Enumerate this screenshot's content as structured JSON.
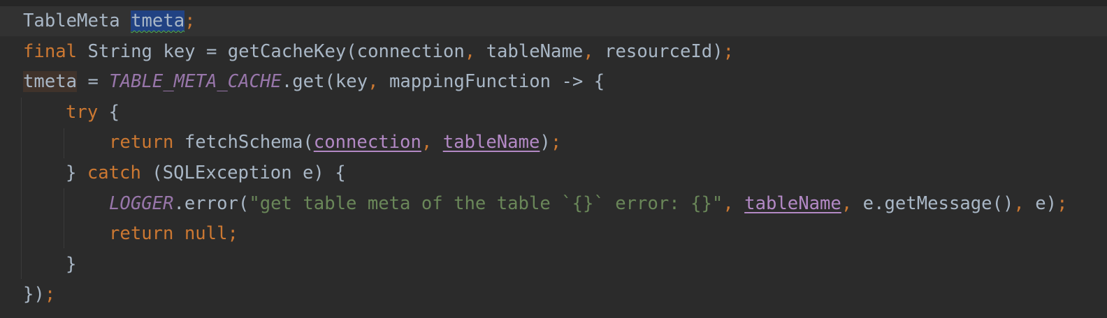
{
  "editor": {
    "lines": [
      {
        "indent": 1,
        "tokens": [
          {
            "t": "TableMeta ",
            "c": "id"
          },
          {
            "t": "tmeta",
            "c": "id sel"
          },
          {
            "t": ";",
            "c": "punc"
          }
        ]
      },
      {
        "indent": 1,
        "tokens": [
          {
            "t": "final",
            "c": "kw"
          },
          {
            "t": " String key = getCacheKey(connection",
            "c": "id"
          },
          {
            "t": ", ",
            "c": "punc"
          },
          {
            "t": "tableName",
            "c": "id"
          },
          {
            "t": ", ",
            "c": "punc"
          },
          {
            "t": "resourceId)",
            "c": "id"
          },
          {
            "t": ";",
            "c": "punc"
          }
        ]
      },
      {
        "indent": 1,
        "tokens": [
          {
            "t": "tmeta",
            "c": "id write-hl"
          },
          {
            "t": " = ",
            "c": "id"
          },
          {
            "t": "TABLE_META_CACHE",
            "c": "static"
          },
          {
            "t": ".get(key",
            "c": "id"
          },
          {
            "t": ", ",
            "c": "punc"
          },
          {
            "t": "mappingFunction -> {",
            "c": "id"
          }
        ]
      },
      {
        "indent": 2,
        "tokens": [
          {
            "t": "try",
            "c": "kw"
          },
          {
            "t": " {",
            "c": "id"
          }
        ]
      },
      {
        "indent": 3,
        "tokens": [
          {
            "t": "return",
            "c": "kw"
          },
          {
            "t": " fetchSchema(",
            "c": "id"
          },
          {
            "t": "connection",
            "c": "param"
          },
          {
            "t": ", ",
            "c": "punc"
          },
          {
            "t": "tableName",
            "c": "param"
          },
          {
            "t": ")",
            "c": "id"
          },
          {
            "t": ";",
            "c": "punc"
          }
        ]
      },
      {
        "indent": 2,
        "tokens": [
          {
            "t": "} ",
            "c": "id"
          },
          {
            "t": "catch",
            "c": "kw"
          },
          {
            "t": " (SQLException e) {",
            "c": "id"
          }
        ]
      },
      {
        "indent": 3,
        "tokens": [
          {
            "t": "LOGGER",
            "c": "static"
          },
          {
            "t": ".error(",
            "c": "id"
          },
          {
            "t": "\"get table meta of the table `{}` error: {}\"",
            "c": "str"
          },
          {
            "t": ", ",
            "c": "punc"
          },
          {
            "t": "tableName",
            "c": "param"
          },
          {
            "t": ", ",
            "c": "punc"
          },
          {
            "t": "e.getMessage()",
            "c": "id"
          },
          {
            "t": ", ",
            "c": "punc"
          },
          {
            "t": "e)",
            "c": "id"
          },
          {
            "t": ";",
            "c": "punc"
          }
        ]
      },
      {
        "indent": 3,
        "tokens": [
          {
            "t": "return null",
            "c": "kw"
          },
          {
            "t": ";",
            "c": "punc"
          }
        ]
      },
      {
        "indent": 2,
        "tokens": [
          {
            "t": "}",
            "c": "id"
          }
        ]
      },
      {
        "indent": 1,
        "tokens": [
          {
            "t": "})",
            "c": "id"
          },
          {
            "t": ";",
            "c": "punc"
          }
        ]
      }
    ]
  },
  "colors": {
    "background": "#2b2b2b",
    "current_line": "#323232",
    "keyword": "#cc7832",
    "identifier": "#a9b7c6",
    "static_field": "#9876aa",
    "string": "#6a8759",
    "parameter": "#b389c5",
    "selection": "#214283"
  }
}
